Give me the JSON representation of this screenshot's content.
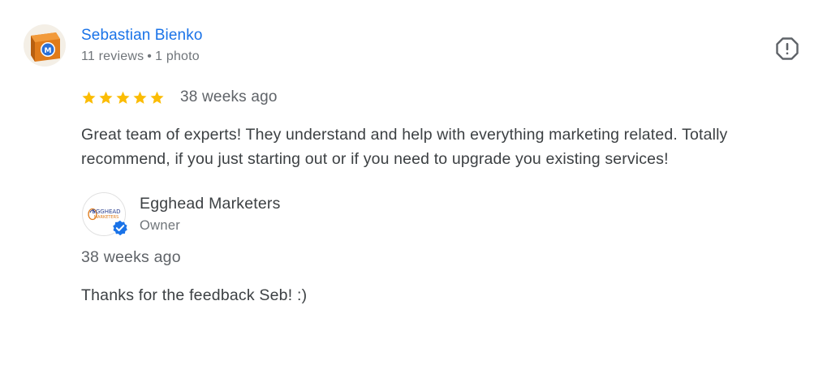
{
  "review": {
    "reviewer": {
      "name": "Sebastian Bienko",
      "reviews_count": "11 reviews",
      "separator": "•",
      "photos_count": "1 photo",
      "avatar_icon": "orange-box-avatar"
    },
    "rating": 5,
    "rating_max": 5,
    "date": "38 weeks ago",
    "text": "Great team of experts! They understand and help with everything marketing related. Totally recommend, if you just starting out or if you need to upgrade you existing services!",
    "flag_icon": "report-icon"
  },
  "owner_response": {
    "business_name": "Egghead Marketers",
    "role": "Owner",
    "logo_text_line1": "EGGHEAD",
    "logo_text_line2": "MARKETERS",
    "verified_icon": "verified-badge-icon",
    "date": "38 weeks ago",
    "text": "Thanks for the feedback Seb! :)"
  },
  "colors": {
    "link": "#1a73e8",
    "star": "#fbbc04",
    "text": "#3c4043",
    "muted": "#70757a",
    "verified": "#1a73e8",
    "avatar_orange": "#e07b1a"
  }
}
